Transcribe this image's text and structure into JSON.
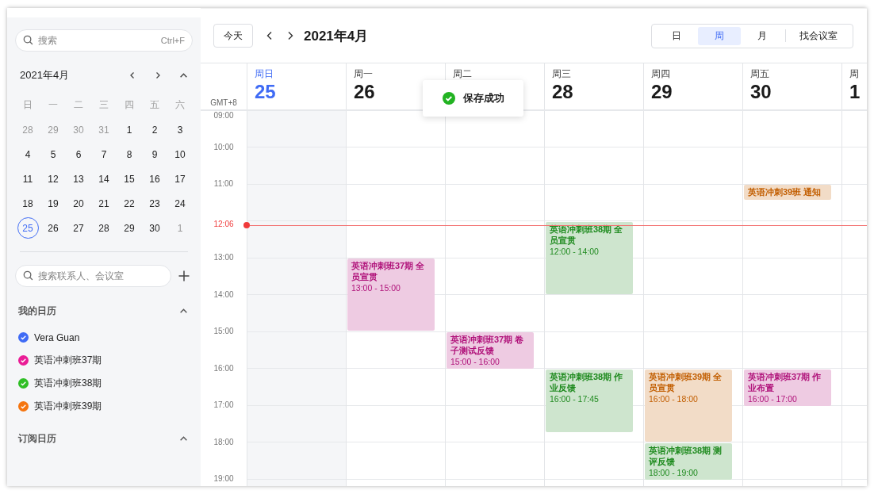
{
  "sidebar": {
    "search": {
      "placeholder": "搜索",
      "shortcut": "Ctrl+F"
    },
    "mini_calendar": {
      "title": "2021年4月",
      "expanded": true,
      "weekdays": [
        "日",
        "一",
        "二",
        "三",
        "四",
        "五",
        "六"
      ],
      "days": [
        {
          "label": "28",
          "muted": true,
          "selected": false
        },
        {
          "label": "29",
          "muted": true,
          "selected": false
        },
        {
          "label": "30",
          "muted": true,
          "selected": false
        },
        {
          "label": "31",
          "muted": true,
          "selected": false
        },
        {
          "label": "1",
          "muted": false,
          "selected": false
        },
        {
          "label": "2",
          "muted": false,
          "selected": false
        },
        {
          "label": "3",
          "muted": false,
          "selected": false
        },
        {
          "label": "4",
          "muted": false,
          "selected": false
        },
        {
          "label": "5",
          "muted": false,
          "selected": false
        },
        {
          "label": "6",
          "muted": false,
          "selected": false
        },
        {
          "label": "7",
          "muted": false,
          "selected": false
        },
        {
          "label": "8",
          "muted": false,
          "selected": false
        },
        {
          "label": "9",
          "muted": false,
          "selected": false
        },
        {
          "label": "10",
          "muted": false,
          "selected": false
        },
        {
          "label": "11",
          "muted": false,
          "selected": false
        },
        {
          "label": "12",
          "muted": false,
          "selected": false
        },
        {
          "label": "13",
          "muted": false,
          "selected": false
        },
        {
          "label": "14",
          "muted": false,
          "selected": false
        },
        {
          "label": "15",
          "muted": false,
          "selected": false
        },
        {
          "label": "16",
          "muted": false,
          "selected": false
        },
        {
          "label": "17",
          "muted": false,
          "selected": false
        },
        {
          "label": "18",
          "muted": false,
          "selected": false
        },
        {
          "label": "19",
          "muted": false,
          "selected": false
        },
        {
          "label": "20",
          "muted": false,
          "selected": false
        },
        {
          "label": "21",
          "muted": false,
          "selected": false
        },
        {
          "label": "22",
          "muted": false,
          "selected": false
        },
        {
          "label": "23",
          "muted": false,
          "selected": false
        },
        {
          "label": "24",
          "muted": false,
          "selected": false
        },
        {
          "label": "25",
          "muted": false,
          "selected": true
        },
        {
          "label": "26",
          "muted": false,
          "selected": false
        },
        {
          "label": "27",
          "muted": false,
          "selected": false
        },
        {
          "label": "28",
          "muted": false,
          "selected": false
        },
        {
          "label": "29",
          "muted": false,
          "selected": false
        },
        {
          "label": "30",
          "muted": false,
          "selected": false
        },
        {
          "label": "1",
          "muted": true,
          "selected": false
        }
      ]
    },
    "contact_search": {
      "placeholder": "搜索联系人、会议室"
    },
    "my_calendars": {
      "title": "我的日历",
      "expanded": true,
      "items": [
        {
          "name": "Vera Guan",
          "color": "#3f6bf5",
          "checked": true
        },
        {
          "name": "英语冲刺班37期",
          "color": "#ea1d96",
          "checked": true
        },
        {
          "name": "英语冲刺班38期",
          "color": "#2fbf25",
          "checked": true
        },
        {
          "name": "英语冲刺班39期",
          "color": "#f5750f",
          "checked": true
        }
      ]
    },
    "subscribed": {
      "title": "订阅日历",
      "expanded": true
    }
  },
  "toolbar": {
    "today_button": "今天",
    "title": "2021年4月",
    "views": [
      {
        "label": "日",
        "selected": false
      },
      {
        "label": "周",
        "selected": true
      },
      {
        "label": "月",
        "selected": false
      },
      {
        "label": "找会议室",
        "selected": false
      }
    ]
  },
  "week": {
    "timezone": "GMT+8",
    "days": [
      {
        "weekday": "周日",
        "date": "25",
        "selected": true
      },
      {
        "weekday": "周一",
        "date": "26",
        "selected": false
      },
      {
        "weekday": "周二",
        "selected": false
      },
      {
        "weekday": "周三",
        "date": "28",
        "selected": false
      },
      {
        "weekday": "周四",
        "date": "29",
        "selected": false
      },
      {
        "weekday": "周五",
        "date": "30",
        "selected": false
      },
      {
        "weekday": "周",
        "date": "1",
        "selected": false
      }
    ],
    "hours": [
      {
        "label": "09:00"
      },
      {
        "label": "10:00"
      },
      {
        "label": "11:00",
        "cells": [
          null,
          null,
          null,
          null,
          null,
          {
            "title": "英语冲刺39班 通知",
            "color": "#c25e00"
          },
          null
        ]
      },
      {
        "cells": [
          null,
          null,
          null,
          {
            "title": "英语冲刺班38期 全员宣贯",
            "time": "12:00 - 14:00",
            "color": "#1e8a1e"
          },
          null,
          null,
          null
        ]
      },
      {
        "label": "13:00",
        "cells": [
          null,
          {
            "title": "英语冲刺班37期 全员宣贯",
            "time": "13:00 - 15:00",
            "color": "#b0127a"
          },
          null,
          null,
          null,
          null,
          null
        ]
      },
      {
        "label": "14:00"
      },
      {
        "label": "15:00",
        "cells": [
          null,
          null,
          {
            "title": "英语冲刺班37期 卷子测试反馈",
            "time": "15:00 - 16:00",
            "color": "#b0127a"
          },
          null,
          null,
          null,
          null
        ]
      },
      {
        "label": "16:00",
        "cells": [
          null,
          null,
          null,
          {
            "title": "英语冲刺班38期 作业反馈",
            "time": "16:00 - 17:45",
            "color": "#1e8a1e"
          },
          {
            "title": "英语冲刺班39期 全员宣贯",
            "time": "16:00 - 18:00",
            "color": "#c25e00"
          },
          {
            "title": "英语冲刺班37期 作业布置",
            "time": "16:00 - 17:00",
            "color": "#b0127a"
          },
          null
        ]
      },
      {
        "label": "17:00"
      },
      {
        "label": "18:00",
        "cells": [
          null,
          null,
          null,
          null,
          {
            "title": "英语冲刺班38期 测评反馈",
            "time": "18:00 - 19:00",
            "color": "#1e8a1e"
          },
          null,
          null
        ]
      },
      {
        "label": "19:00"
      }
    ],
    "now": "12:06"
  },
  "toast": {
    "text": "保存成功",
    "kind": "success"
  }
}
